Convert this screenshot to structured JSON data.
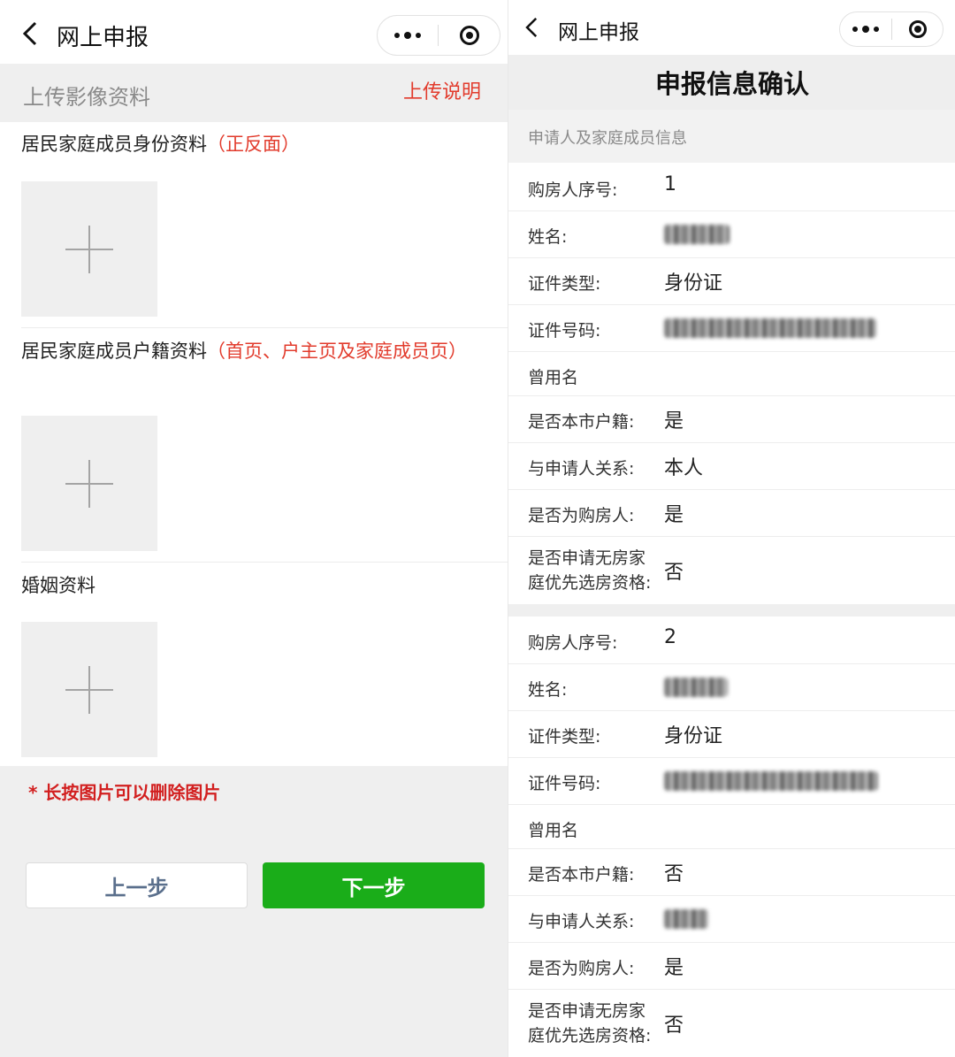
{
  "left": {
    "nav": {
      "title": "网上申报"
    },
    "section": {
      "title": "上传影像资料",
      "link": "上传说明"
    },
    "uploads": [
      {
        "label": "居民家庭成员身份资料",
        "note": "（正反面）"
      },
      {
        "label": "居民家庭成员户籍资料",
        "note": "（首页、户主页及家庭成员页）"
      },
      {
        "label": "婚姻资料",
        "note": ""
      }
    ],
    "hint": "* 长按图片可以删除图片",
    "buttons": {
      "prev": "上一步",
      "next": "下一步"
    }
  },
  "right": {
    "nav": {
      "title": "网上申报"
    },
    "title": "申报信息确认",
    "group_label": "申请人及家庭成员信息",
    "buyers": [
      {
        "seq_label": "购房人序号:",
        "seq": "1",
        "name_label": "姓名:",
        "idtype_label": "证件类型:",
        "idtype": "身份证",
        "idno_label": "证件号码:",
        "former_label": "曾用名",
        "hukou_label": "是否本市户籍:",
        "hukou": "是",
        "relation_label": "与申请人关系:",
        "relation": "本人",
        "isbuyer_label": "是否为购房人:",
        "isbuyer": "是",
        "priority_label_1": "是否申请无房家",
        "priority_label_2": "庭优先选房资格:",
        "priority": "否"
      },
      {
        "seq_label": "购房人序号:",
        "seq": "2",
        "name_label": "姓名:",
        "idtype_label": "证件类型:",
        "idtype": "身份证",
        "idno_label": "证件号码:",
        "former_label": "曾用名",
        "hukou_label": "是否本市户籍:",
        "hukou": "否",
        "relation_label": "与申请人关系:",
        "isbuyer_label": "是否为购房人:",
        "isbuyer": "是",
        "priority_label_1": "是否申请无房家",
        "priority_label_2": "庭优先选房资格:",
        "priority": "否"
      }
    ]
  }
}
